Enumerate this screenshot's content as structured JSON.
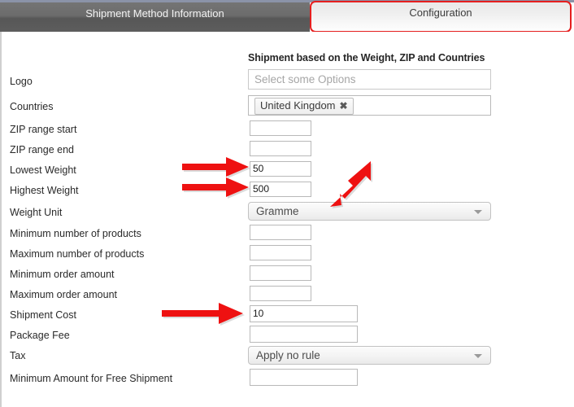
{
  "tabs": [
    {
      "label": "Shipment Method Information",
      "active": false
    },
    {
      "label": "Configuration",
      "active": true
    }
  ],
  "section": {
    "title": "Shipment based on the Weight, ZIP and Countries"
  },
  "form": {
    "rows": [
      {
        "label": "Logo",
        "control": "multiselect",
        "value": "",
        "placeholder": "Select some Options"
      },
      {
        "label": "Countries",
        "control": "tags",
        "value": "United Kingdom",
        "remove_label": "✖"
      },
      {
        "label": "ZIP range start",
        "control": "text-small",
        "value": ""
      },
      {
        "label": "ZIP range end",
        "control": "text-small",
        "value": ""
      },
      {
        "label": "Lowest Weight",
        "control": "text-small",
        "value": "50"
      },
      {
        "label": "Highest Weight",
        "control": "text-small",
        "value": "500"
      },
      {
        "label": "Weight Unit",
        "control": "select",
        "value": "Gramme"
      },
      {
        "label": "Minimum number of products",
        "control": "text-small",
        "value": ""
      },
      {
        "label": "Maximum number of products",
        "control": "text-small",
        "value": ""
      },
      {
        "label": "Minimum order amount",
        "control": "text-small",
        "value": ""
      },
      {
        "label": "Maximum order amount",
        "control": "text-small",
        "value": ""
      },
      {
        "label": "Shipment Cost",
        "control": "text-wide",
        "value": "10"
      },
      {
        "label": "Package Fee",
        "control": "text-wide",
        "value": ""
      },
      {
        "label": "Tax",
        "control": "select",
        "value": "Apply no rule"
      },
      {
        "label": "Minimum Amount for Free Shipment",
        "control": "text-wide",
        "value": ""
      }
    ]
  },
  "annotations": {
    "color": "#ee1111",
    "arrows": [
      {
        "name": "arrow-lowest-weight",
        "target": "Lowest Weight"
      },
      {
        "name": "arrow-highest-weight",
        "target": "Highest Weight"
      },
      {
        "name": "arrow-weight-unit",
        "target": "Weight Unit"
      },
      {
        "name": "arrow-shipment-cost",
        "target": "Shipment Cost"
      }
    ]
  },
  "colors": {
    "tab_active_outline": "#e51f1f",
    "tab_inactive_bg": "#6c6c6c",
    "annotation_red": "#ee1111"
  }
}
